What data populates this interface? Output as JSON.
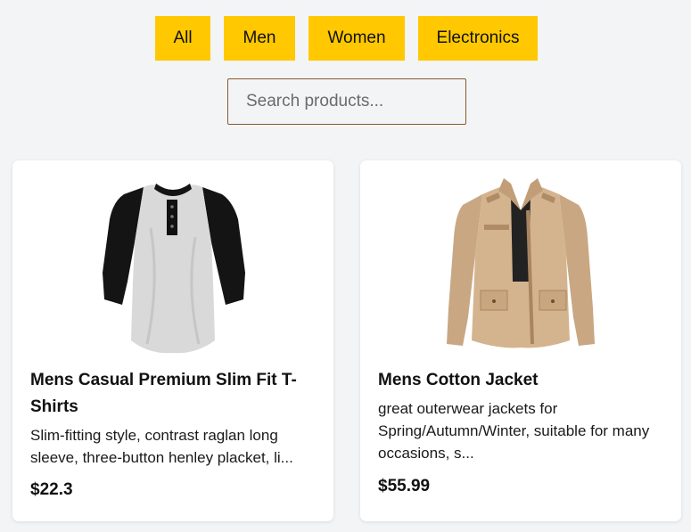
{
  "filters": {
    "all": "All",
    "men": "Men",
    "women": "Women",
    "electronics": "Electronics"
  },
  "search": {
    "placeholder": "Search products..."
  },
  "products": [
    {
      "title": "Mens Casual Premium Slim Fit T-Shirts",
      "description": "Slim-fitting style, contrast raglan long sleeve, three-button henley placket, li...",
      "price": "$22.3",
      "image": "raglan-henley-tshirt-image"
    },
    {
      "title": "Mens Cotton Jacket",
      "description": "great outerwear jackets for Spring/Autumn/Winter, suitable for many occasions, s...",
      "price": "$55.99",
      "image": "khaki-cotton-jacket-image"
    }
  ],
  "colors": {
    "accent": "#ffc800",
    "background": "#f3f4f6",
    "search_border": "#8a5a2b"
  }
}
